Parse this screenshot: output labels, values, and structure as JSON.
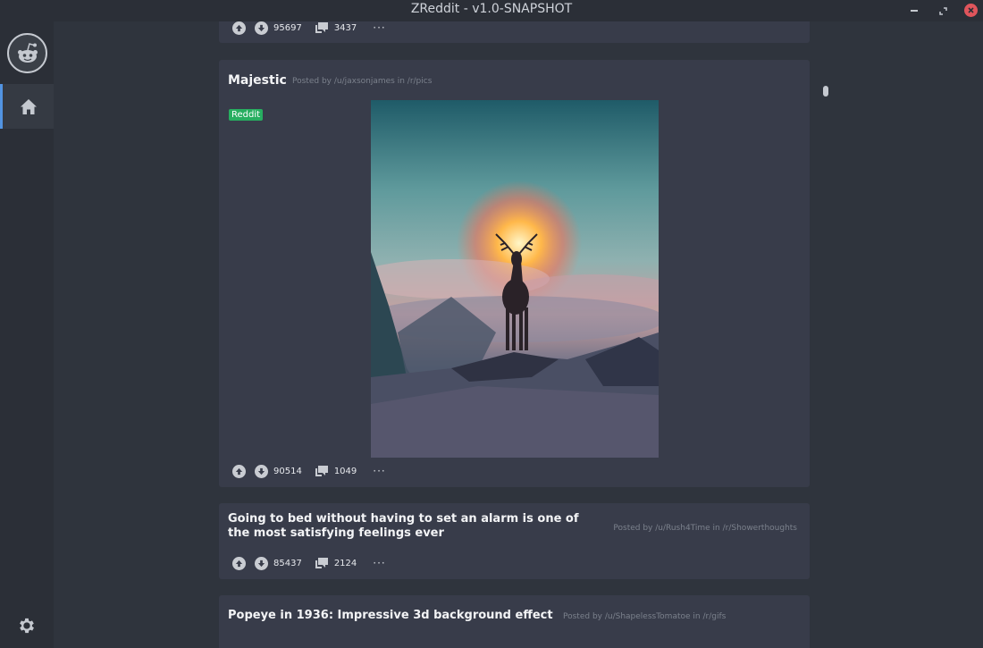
{
  "window": {
    "title": "ZReddit - v1.0-SNAPSHOT"
  },
  "sidebar": {
    "logo_icon": "reddit-alien-icon",
    "home_icon": "home-icon",
    "settings_icon": "gear-icon",
    "accent": "#5294e2"
  },
  "posts": [
    {
      "upvotes": "95697",
      "comments": "3437",
      "more": "···"
    },
    {
      "title": "Majestic",
      "meta": "Posted by /u/jaxsonjames  in /r/pics",
      "flair": "Reddit",
      "upvotes": "90514",
      "comments": "1049",
      "more": "···"
    },
    {
      "title": "Going to bed without having to set an alarm is one of the most satisfying feelings ever",
      "meta": "Posted by /u/Rush4Time  in /r/Showerthoughts",
      "upvotes": "85437",
      "comments": "2124",
      "more": "···"
    },
    {
      "title": "Popeye in 1936: Impressive 3d background effect",
      "meta": "Posted by /u/ShapelessTomatoe  in /r/gifs"
    }
  ]
}
